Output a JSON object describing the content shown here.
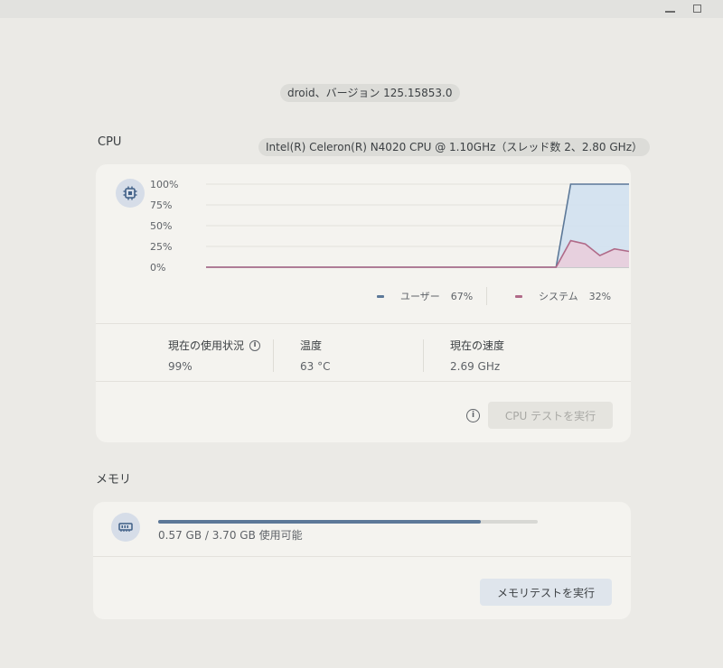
{
  "header": {
    "version": "droid、バージョン 125.15853.0"
  },
  "cpu": {
    "section_title": "CPU",
    "chip": "Intel(R) Celeron(R) N4020 CPU @ 1.10GHz（スレッド数 2、2.80 GHz）",
    "icon": "cpu-chip-icon",
    "legend": {
      "user_label": "ユーザー",
      "user_value": "67%",
      "system_label": "システム",
      "system_value": "32%"
    },
    "stats": {
      "usage_label": "現在の使用状況",
      "usage_value": "99%",
      "temp_label": "温度",
      "temp_value": "63 °C",
      "speed_label": "現在の速度",
      "speed_value": "2.69 GHz"
    },
    "run_button": "CPU テストを実行",
    "colors": {
      "user": "#5c7898",
      "system": "#b06a88",
      "user_fill": "#d2e1ef",
      "system_fill": "#e9cddc"
    }
  },
  "memory": {
    "section_title": "メモリ",
    "icon": "memory-icon",
    "usage_text": "0.57 GB / 3.70 GB 使用可能",
    "fill_fraction": 0.85,
    "run_button": "メモリテストを実行"
  },
  "chart_data": {
    "type": "area",
    "ylim": [
      0,
      100
    ],
    "yticks": [
      "100%",
      "75%",
      "50%",
      "25%",
      "0%"
    ],
    "x": [
      0,
      1,
      2,
      3,
      4,
      5,
      6,
      7,
      8,
      9,
      10,
      11,
      12,
      13,
      14,
      15,
      16,
      17,
      18,
      19,
      20,
      21,
      22,
      23,
      24,
      25,
      26,
      27,
      28,
      29
    ],
    "series": [
      {
        "name": "ユーザー",
        "values": [
          0,
          0,
          0,
          0,
          0,
          0,
          0,
          0,
          0,
          0,
          0,
          0,
          0,
          0,
          0,
          0,
          0,
          0,
          0,
          0,
          0,
          0,
          0,
          0,
          0,
          100,
          100,
          100,
          100,
          100
        ]
      },
      {
        "name": "システム",
        "values": [
          0,
          0,
          0,
          0,
          0,
          0,
          0,
          0,
          0,
          0,
          0,
          0,
          0,
          0,
          0,
          0,
          0,
          0,
          0,
          0,
          0,
          0,
          0,
          0,
          0,
          32,
          28,
          14,
          22,
          19
        ]
      }
    ]
  }
}
